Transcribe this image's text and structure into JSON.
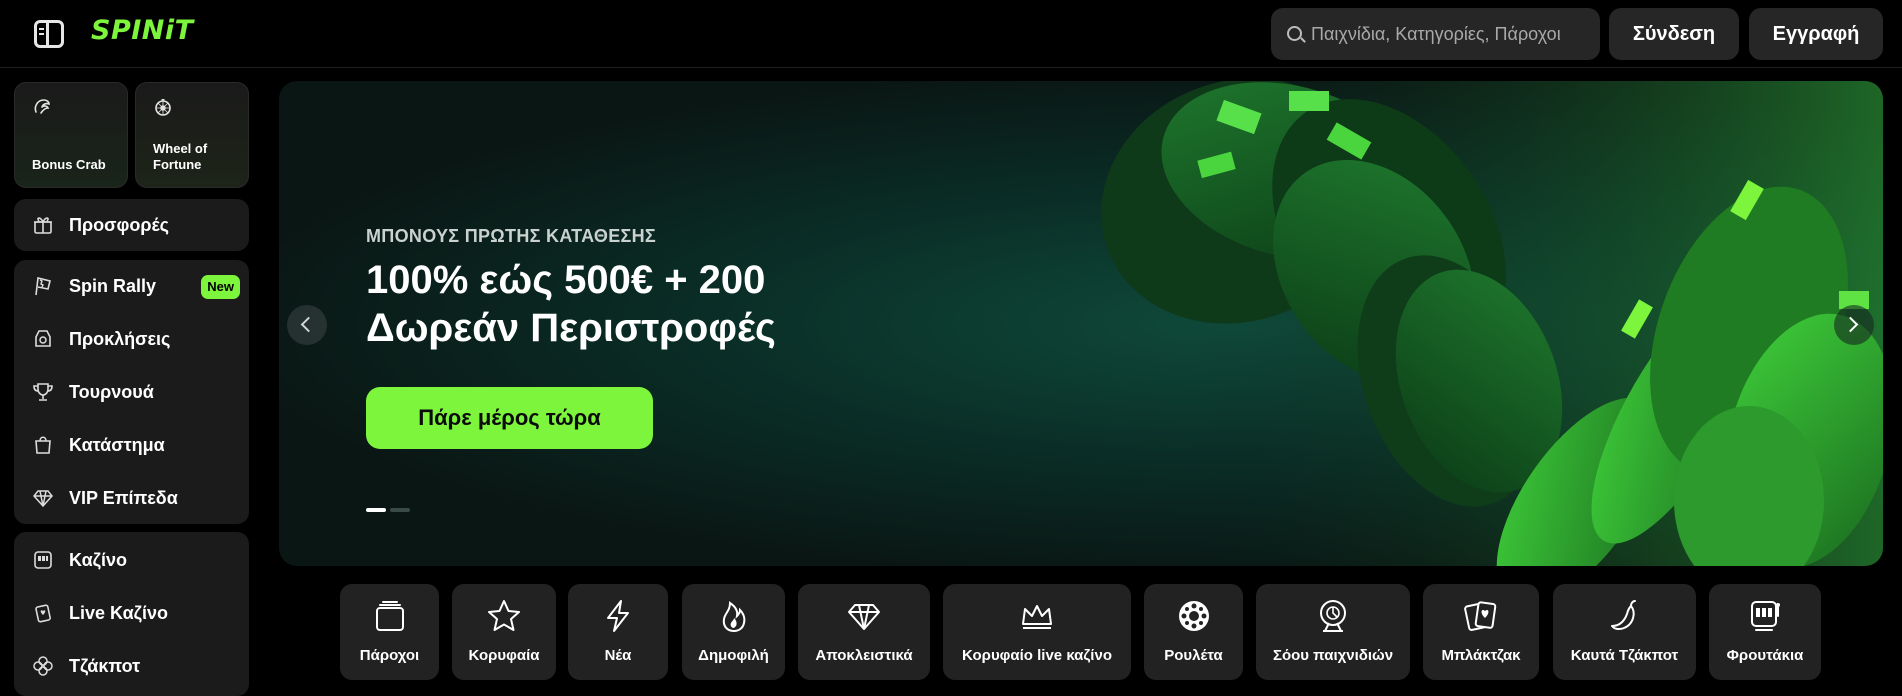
{
  "header": {
    "logo": "SPINiT",
    "search_placeholder": "Παιχνίδια, Κατηγορίες, Πάροχοι",
    "login_label": "Σύνδεση",
    "register_label": "Εγγραφή"
  },
  "sidebar": {
    "quick": [
      {
        "label": "Bonus Crab",
        "icon": "crab-claw-icon"
      },
      {
        "label": "Wheel of Fortune",
        "icon": "wheel-icon"
      }
    ],
    "promos": {
      "label": "Προσφορές",
      "icon": "gift-icon"
    },
    "group1": [
      {
        "label": "Spin Rally",
        "icon": "racing-flag-icon",
        "badge": "New"
      },
      {
        "label": "Προκλήσεις",
        "icon": "challenge-icon"
      },
      {
        "label": "Τουρνουά",
        "icon": "trophy-icon"
      },
      {
        "label": "Κατάστημα",
        "icon": "shopping-bag-icon"
      },
      {
        "label": "VIP Επίπεδα",
        "icon": "diamond-icon"
      }
    ],
    "group2": [
      {
        "label": "Καζίνο",
        "icon": "slot-machine-icon"
      },
      {
        "label": "Live Καζίνο",
        "icon": "live-cards-icon"
      },
      {
        "label": "Τζάκποτ",
        "icon": "clover-icon"
      }
    ]
  },
  "hero": {
    "subtitle": "ΜΠΟΝΟΥΣ ΠΡΩΤΗΣ ΚΑΤΑΘΕΣΗΣ",
    "title_line1": "100% εώς 500€ + 200",
    "title_line2": "Δωρεάν Περιστροφές",
    "cta_label": "Πάρε μέρος τώρα",
    "slide_count": 2,
    "active_slide": 1
  },
  "categories": [
    {
      "label": "Πάροχοι",
      "icon": "providers-stack-icon"
    },
    {
      "label": "Κορυφαία",
      "icon": "star-icon"
    },
    {
      "label": "Νέα",
      "icon": "lightning-icon"
    },
    {
      "label": "Δημοφιλή",
      "icon": "flame-icon"
    },
    {
      "label": "Αποκλειστικά",
      "icon": "diamond-icon"
    },
    {
      "label": "Κορυφαίο live καζίνο",
      "icon": "crown-icon"
    },
    {
      "label": "Ρουλέτα",
      "icon": "roulette-icon"
    },
    {
      "label": "Σόου παιχνιδιών",
      "icon": "game-show-wheel-icon"
    },
    {
      "label": "Μπλάκτζακ",
      "icon": "cards-icon"
    },
    {
      "label": "Καυτά Τζάκποτ",
      "icon": "chili-icon"
    },
    {
      "label": "Φρουτάκια",
      "icon": "slot-machine-icon"
    }
  ],
  "colors": {
    "brand_green": "#7cf53c",
    "panel": "#1b1b1b",
    "tile": "#222222"
  }
}
